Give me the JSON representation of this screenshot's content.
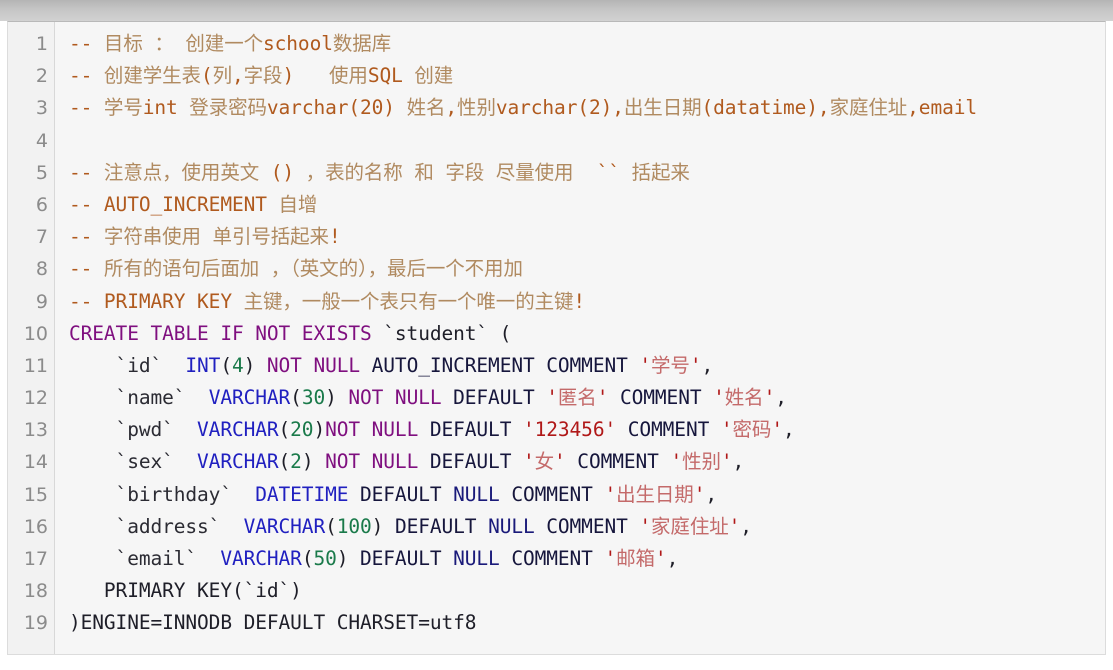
{
  "window": {
    "type": "code-viewer",
    "top_strip_color": "#c4c4c4",
    "card_background": "#f6f6f6",
    "gutter_background": "#f2f2f2"
  },
  "palette": {
    "comment_ascii": "#b05a1e",
    "comment_cjk": "#b08a60",
    "keyword": "#7f0f7f",
    "datatype": "#2020c0",
    "number": "#1a7a4a",
    "string_ascii": "#b01818",
    "string_cjk": "#c46a6a",
    "plain": "#1a1a24",
    "linenumber": "#8b8b8b"
  },
  "editor": {
    "language": "sql",
    "first_line": 1,
    "last_line": 19,
    "line_numbers": [
      "1",
      "2",
      "3",
      "4",
      "5",
      "6",
      "7",
      "8",
      "9",
      "10",
      "11",
      "12",
      "13",
      "14",
      "15",
      "16",
      "17",
      "18",
      "19"
    ],
    "lines": [
      {
        "n": "1",
        "text": "-- 目标 : 创建一个school数据库",
        "tokens": [
          {
            "t": "-- ",
            "c": "com"
          },
          {
            "t": "目标 ： 创建一个",
            "c": "comz"
          },
          {
            "t": "school",
            "c": "com"
          },
          {
            "t": "数据库",
            "c": "comz"
          }
        ]
      },
      {
        "n": "2",
        "text": "-- 创建学生表(列,字段)   使用SQL 创建",
        "tokens": [
          {
            "t": "-- ",
            "c": "com"
          },
          {
            "t": "创建学生表",
            "c": "comz"
          },
          {
            "t": "(",
            "c": "com"
          },
          {
            "t": "列",
            "c": "comz"
          },
          {
            "t": ",",
            "c": "com"
          },
          {
            "t": "字段",
            "c": "comz"
          },
          {
            "t": ")   ",
            "c": "com"
          },
          {
            "t": "使用",
            "c": "comz"
          },
          {
            "t": "SQL ",
            "c": "com"
          },
          {
            "t": "创建",
            "c": "comz"
          }
        ]
      },
      {
        "n": "3",
        "text": "-- 学号int 登录密码varchar(20) 姓名,性别varchar(2),出生日期(datatime),家庭住址,email",
        "tokens": [
          {
            "t": "-- ",
            "c": "com"
          },
          {
            "t": "学号",
            "c": "comz"
          },
          {
            "t": "int ",
            "c": "com"
          },
          {
            "t": "登录密码",
            "c": "comz"
          },
          {
            "t": "varchar(20) ",
            "c": "com"
          },
          {
            "t": "姓名",
            "c": "comz"
          },
          {
            "t": ",",
            "c": "com"
          },
          {
            "t": "性别",
            "c": "comz"
          },
          {
            "t": "varchar(2),",
            "c": "com"
          },
          {
            "t": "出生日期",
            "c": "comz"
          },
          {
            "t": "(datatime),",
            "c": "com"
          },
          {
            "t": "家庭住址",
            "c": "comz"
          },
          {
            "t": ",email",
            "c": "com"
          }
        ]
      },
      {
        "n": "4",
        "text": "",
        "tokens": []
      },
      {
        "n": "5",
        "text": "-- 注意点，使用英文 () ，表的名称 和 字段 尽量使用  `` 括起来",
        "tokens": [
          {
            "t": "-- ",
            "c": "com"
          },
          {
            "t": "注意点，使用英文 ",
            "c": "comz"
          },
          {
            "t": "()",
            "c": "com"
          },
          {
            "t": " ，表的名称 和 字段 尽量使用  ",
            "c": "comz"
          },
          {
            "t": "``",
            "c": "com"
          },
          {
            "t": " 括起来",
            "c": "comz"
          }
        ]
      },
      {
        "n": "6",
        "text": "-- AUTO_INCREMENT 自增",
        "tokens": [
          {
            "t": "-- AUTO_INCREMENT ",
            "c": "com"
          },
          {
            "t": "自增",
            "c": "comz"
          }
        ]
      },
      {
        "n": "7",
        "text": "-- 字符串使用 单引号括起来!",
        "tokens": [
          {
            "t": "-- ",
            "c": "com"
          },
          {
            "t": "字符串使用 单引号括起来",
            "c": "comz"
          },
          {
            "t": "!",
            "c": "com"
          }
        ]
      },
      {
        "n": "8",
        "text": "-- 所有的语句后面加 ，（英文的），最后一个不用加",
        "tokens": [
          {
            "t": "-- ",
            "c": "com"
          },
          {
            "t": "所有的语句后面加 ，（英文的），最后一个不用加",
            "c": "comz"
          }
        ]
      },
      {
        "n": "9",
        "text": "-- PRIMARY KEY 主键，一般一个表只有一个唯一的主键!",
        "tokens": [
          {
            "t": "-- PRIMARY KEY ",
            "c": "com"
          },
          {
            "t": "主键，一般一个表只有一个唯一的主键",
            "c": "comz"
          },
          {
            "t": "!",
            "c": "com"
          }
        ]
      },
      {
        "n": "10",
        "text": "CREATE TABLE IF NOT EXISTS `student` (",
        "tokens": [
          {
            "t": "CREATE TABLE IF NOT EXISTS",
            "c": "kw"
          },
          {
            "t": " `student` (",
            "c": "plain"
          }
        ]
      },
      {
        "n": "11",
        "text": "    `id` INT(4) NOT NULL AUTO_INCREMENT COMMENT '学号',",
        "tokens": [
          {
            "t": "    `id`  ",
            "c": "ident"
          },
          {
            "t": "INT",
            "c": "type"
          },
          {
            "t": "(",
            "c": "plain"
          },
          {
            "t": "4",
            "c": "num"
          },
          {
            "t": ") ",
            "c": "plain"
          },
          {
            "t": "NOT NULL",
            "c": "kw"
          },
          {
            "t": " AUTO_INCREMENT COMMENT ",
            "c": "nav"
          },
          {
            "t": "'",
            "c": "str"
          },
          {
            "t": "学号",
            "c": "strz"
          },
          {
            "t": "'",
            "c": "str"
          },
          {
            "t": ",",
            "c": "plain"
          }
        ]
      },
      {
        "n": "12",
        "text": "    `name` VARCHAR(30) NOT NULL DEFAULT '匿名' COMMENT '姓名',",
        "tokens": [
          {
            "t": "    `name`  ",
            "c": "ident"
          },
          {
            "t": "VARCHAR",
            "c": "type"
          },
          {
            "t": "(",
            "c": "plain"
          },
          {
            "t": "30",
            "c": "num"
          },
          {
            "t": ") ",
            "c": "plain"
          },
          {
            "t": "NOT NULL",
            "c": "kw"
          },
          {
            "t": " DEFAULT ",
            "c": "nav"
          },
          {
            "t": "'",
            "c": "str"
          },
          {
            "t": "匿名",
            "c": "strz"
          },
          {
            "t": "'",
            "c": "str"
          },
          {
            "t": " COMMENT ",
            "c": "nav"
          },
          {
            "t": "'",
            "c": "str"
          },
          {
            "t": "姓名",
            "c": "strz"
          },
          {
            "t": "'",
            "c": "str"
          },
          {
            "t": ",",
            "c": "plain"
          }
        ]
      },
      {
        "n": "13",
        "text": "    `pwd` VARCHAR(20)NOT NULL DEFAULT '123456' COMMENT '密码',",
        "tokens": [
          {
            "t": "    `pwd`  ",
            "c": "ident"
          },
          {
            "t": "VARCHAR",
            "c": "type"
          },
          {
            "t": "(",
            "c": "plain"
          },
          {
            "t": "20",
            "c": "num"
          },
          {
            "t": ")",
            "c": "plain"
          },
          {
            "t": "NOT NULL",
            "c": "kw"
          },
          {
            "t": " DEFAULT ",
            "c": "nav"
          },
          {
            "t": "'123456'",
            "c": "str"
          },
          {
            "t": " COMMENT ",
            "c": "nav"
          },
          {
            "t": "'",
            "c": "str"
          },
          {
            "t": "密码",
            "c": "strz"
          },
          {
            "t": "'",
            "c": "str"
          },
          {
            "t": ",",
            "c": "plain"
          }
        ]
      },
      {
        "n": "14",
        "text": "    `sex` VARCHAR(2) NOT NULL DEFAULT '女' COMMENT '性别',",
        "tokens": [
          {
            "t": "    `sex`  ",
            "c": "ident"
          },
          {
            "t": "VARCHAR",
            "c": "type"
          },
          {
            "t": "(",
            "c": "plain"
          },
          {
            "t": "2",
            "c": "num"
          },
          {
            "t": ") ",
            "c": "plain"
          },
          {
            "t": "NOT NULL",
            "c": "kw"
          },
          {
            "t": " DEFAULT ",
            "c": "nav"
          },
          {
            "t": "'",
            "c": "str"
          },
          {
            "t": "女",
            "c": "strz"
          },
          {
            "t": "'",
            "c": "str"
          },
          {
            "t": " COMMENT ",
            "c": "nav"
          },
          {
            "t": "'",
            "c": "str"
          },
          {
            "t": "性别",
            "c": "strz"
          },
          {
            "t": "'",
            "c": "str"
          },
          {
            "t": ",",
            "c": "plain"
          }
        ]
      },
      {
        "n": "15",
        "text": "    `birthday` DATETIME DEFAULT NULL COMMENT '出生日期',",
        "tokens": [
          {
            "t": "    `birthday`  ",
            "c": "ident"
          },
          {
            "t": "DATETIME",
            "c": "type"
          },
          {
            "t": " DEFAULT ",
            "c": "nav"
          },
          {
            "t": "NULL",
            "c": "null"
          },
          {
            "t": " COMMENT ",
            "c": "nav"
          },
          {
            "t": "'",
            "c": "str"
          },
          {
            "t": "出生日期",
            "c": "strz"
          },
          {
            "t": "'",
            "c": "str"
          },
          {
            "t": ",",
            "c": "plain"
          }
        ]
      },
      {
        "n": "16",
        "text": "    `address` VARCHAR(100) DEFAULT NULL COMMENT '家庭住址',",
        "tokens": [
          {
            "t": "    `address`  ",
            "c": "ident"
          },
          {
            "t": "VARCHAR",
            "c": "type"
          },
          {
            "t": "(",
            "c": "plain"
          },
          {
            "t": "100",
            "c": "num"
          },
          {
            "t": ") ",
            "c": "plain"
          },
          {
            "t": "DEFAULT ",
            "c": "nav"
          },
          {
            "t": "NULL",
            "c": "null"
          },
          {
            "t": " COMMENT ",
            "c": "nav"
          },
          {
            "t": "'",
            "c": "str"
          },
          {
            "t": "家庭住址",
            "c": "strz"
          },
          {
            "t": "'",
            "c": "str"
          },
          {
            "t": ",",
            "c": "plain"
          }
        ]
      },
      {
        "n": "17",
        "text": "    `email` VARCHAR(50) DEFAULT NULL COMMENT '邮箱',",
        "tokens": [
          {
            "t": "    `email`  ",
            "c": "ident"
          },
          {
            "t": "VARCHAR",
            "c": "type"
          },
          {
            "t": "(",
            "c": "plain"
          },
          {
            "t": "50",
            "c": "num"
          },
          {
            "t": ") ",
            "c": "plain"
          },
          {
            "t": "DEFAULT ",
            "c": "nav"
          },
          {
            "t": "NULL",
            "c": "null"
          },
          {
            "t": " COMMENT ",
            "c": "nav"
          },
          {
            "t": "'",
            "c": "str"
          },
          {
            "t": "邮箱",
            "c": "strz"
          },
          {
            "t": "'",
            "c": "str"
          },
          {
            "t": ",",
            "c": "plain"
          }
        ]
      },
      {
        "n": "18",
        "text": "   PRIMARY KEY(`id`)",
        "tokens": [
          {
            "t": "   PRIMARY KEY(`id`)",
            "c": "plain"
          }
        ]
      },
      {
        "n": "19",
        "text": ")ENGINE=INNODB DEFAULT CHARSET=utf8",
        "tokens": [
          {
            "t": ")ENGINE=INNODB DEFAULT CHARSET=utf8",
            "c": "plain"
          }
        ]
      }
    ]
  }
}
